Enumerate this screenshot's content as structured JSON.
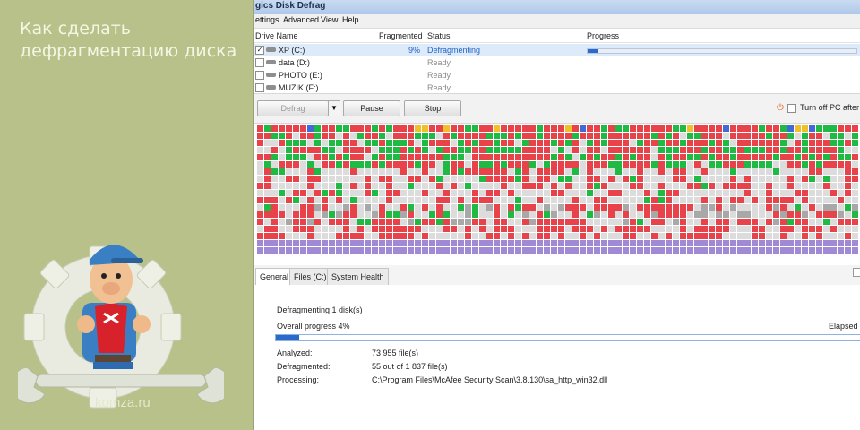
{
  "promo": {
    "title_line1": "Как сделать",
    "title_line2": "дефрагментацию диска",
    "site": "komza.ru"
  },
  "window": {
    "title": "gics Disk Defrag",
    "menu": [
      "ettings",
      "Advanced",
      "View",
      "Help"
    ]
  },
  "drives": {
    "columns": [
      "Drive Name",
      "Fragmented",
      "Status",
      "Progress"
    ],
    "rows": [
      {
        "checked": "✓",
        "name": "XP (C:)",
        "fragmented": "9%",
        "status": "Defragmenting",
        "progress": 0.04
      },
      {
        "checked": "",
        "name": "data (D:)",
        "fragmented": "",
        "status": "Ready",
        "progress": 0
      },
      {
        "checked": "",
        "name": "PHOTO (E:)",
        "fragmented": "",
        "status": "Ready",
        "progress": 0
      },
      {
        "checked": "",
        "name": "MUZIK (F:)",
        "fragmented": "",
        "status": "Ready",
        "progress": 0
      }
    ]
  },
  "toolbar": {
    "defrag_label": "Defrag",
    "dropdown_arrow": "▼",
    "pause_label": "Pause",
    "stop_label": "Stop",
    "power_icon": "⏻",
    "turnoff_label": "Turn off PC after d"
  },
  "cluster_map": {
    "colors": {
      "fragmented": "#e8424a",
      "defragmented": "#1fba44",
      "free": "#dcdcdc",
      "system": "#a08ad6",
      "mft": "#a8a8a8",
      "misc_blue": "#3f6ad8",
      "misc_yellow": "#f0c02a"
    }
  },
  "tabs": [
    "General",
    "Files (C:)",
    "System Health"
  ],
  "general": {
    "heading": "Defragmenting 1 disk(s)",
    "overall_label": "Overall progress 4%",
    "overall_value": 0.04,
    "elapsed_label": "Elapsed t",
    "analyzed_label": "Analyzed:",
    "analyzed_value": "73 955 file(s)",
    "defragmented_label": "Defragmented:",
    "defragmented_value": "55 out of 1 837 file(s)",
    "processing_label": "Processing:",
    "processing_value": "C:\\Program Files\\McAfee Security Scan\\3.8.130\\sa_http_win32.dll"
  }
}
